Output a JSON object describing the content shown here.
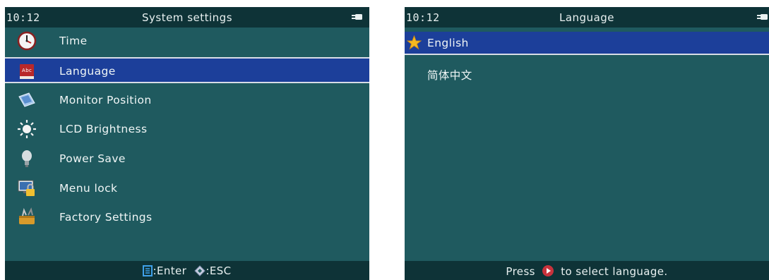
{
  "left_screen": {
    "clock": "10:12",
    "title": "System settings",
    "menu": [
      {
        "label": "Time",
        "icon": "clock-icon"
      },
      {
        "label": "Language",
        "icon": "dictionary-book-icon",
        "selected": true
      },
      {
        "label": "Monitor Position",
        "icon": "monitor-position-icon"
      },
      {
        "label": "LCD Brightness",
        "icon": "sun-brightness-icon"
      },
      {
        "label": "Power Save",
        "icon": "light-bulb-icon"
      },
      {
        "label": "Menu lock",
        "icon": "padlock-monitor-icon"
      },
      {
        "label": "Factory Settings",
        "icon": "toolbox-icon"
      }
    ],
    "footer": {
      "enter_label": ":Enter",
      "esc_label": ":ESC"
    }
  },
  "right_screen": {
    "clock": "10:12",
    "title": "Language",
    "languages": [
      {
        "label": "English",
        "selected": true,
        "icon": "star-icon"
      },
      {
        "label": "简体中文"
      }
    ],
    "footer": {
      "prefix": "Press",
      "suffix": "to select language."
    }
  },
  "colors": {
    "screen_bg": "#1f5a5f",
    "bar_bg": "#0e3337",
    "selection": "#1c3f9a",
    "text": "#f0f6f6"
  }
}
